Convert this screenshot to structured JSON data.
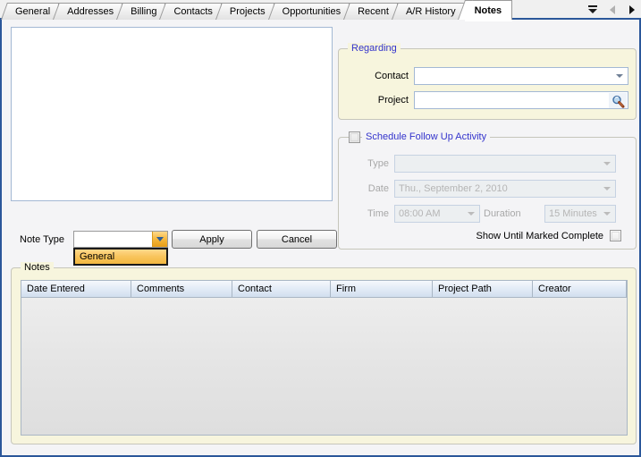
{
  "window": {
    "accent_border": "#2b579a",
    "panel_bg": "#f4f4f6",
    "group_bg": "#f7f5dd"
  },
  "tabs": {
    "items": [
      {
        "label": "General",
        "active": false
      },
      {
        "label": "Addresses",
        "active": false
      },
      {
        "label": "Billing",
        "active": false
      },
      {
        "label": "Contacts",
        "active": false
      },
      {
        "label": "Projects",
        "active": false
      },
      {
        "label": "Opportunities",
        "active": false
      },
      {
        "label": "Recent",
        "active": false
      },
      {
        "label": "A/R History",
        "active": false
      },
      {
        "label": "Notes",
        "active": true
      }
    ],
    "nav": {
      "list_icon": "double-chevron-down-icon",
      "prev_icon": "arrow-left-icon",
      "next_icon": "arrow-right-icon",
      "prev_enabled": false,
      "next_enabled": true
    }
  },
  "note_editor": {
    "value": "",
    "placeholder": ""
  },
  "regarding": {
    "title": "Regarding",
    "title_color": "#3333cc",
    "contact": {
      "label": "Contact",
      "value": "",
      "enabled": true
    },
    "project": {
      "label": "Project",
      "value": "",
      "enabled": true,
      "search_icon": "magnifier-icon"
    }
  },
  "schedule": {
    "title": "Schedule Follow Up Activity",
    "title_color": "#3333cc",
    "checked": false,
    "type": {
      "label": "Type",
      "value": "",
      "enabled": false
    },
    "date": {
      "label": "Date",
      "value": "Thu., September 2, 2010",
      "enabled": false
    },
    "time": {
      "label": "Time",
      "value": "08:00 AM",
      "enabled": false
    },
    "duration": {
      "label": "Duration",
      "value": "15 Minutes",
      "enabled": false
    },
    "show_until": {
      "label": "Show Until Marked Complete",
      "checked": false
    }
  },
  "note_type": {
    "label": "Note Type",
    "value": "",
    "dropdown_open": true,
    "options": [
      {
        "label": "General",
        "selected": true
      }
    ]
  },
  "actions": {
    "apply_label": "Apply",
    "cancel_label": "Cancel"
  },
  "notes_grid": {
    "title": "Notes",
    "columns": [
      {
        "label": "Date Entered",
        "width": 123
      },
      {
        "label": "Comments",
        "width": 113
      },
      {
        "label": "Contact",
        "width": 110
      },
      {
        "label": "Firm",
        "width": 114
      },
      {
        "label": "Project Path",
        "width": 112
      },
      {
        "label": "Creator",
        "width": 105
      }
    ],
    "rows": []
  }
}
